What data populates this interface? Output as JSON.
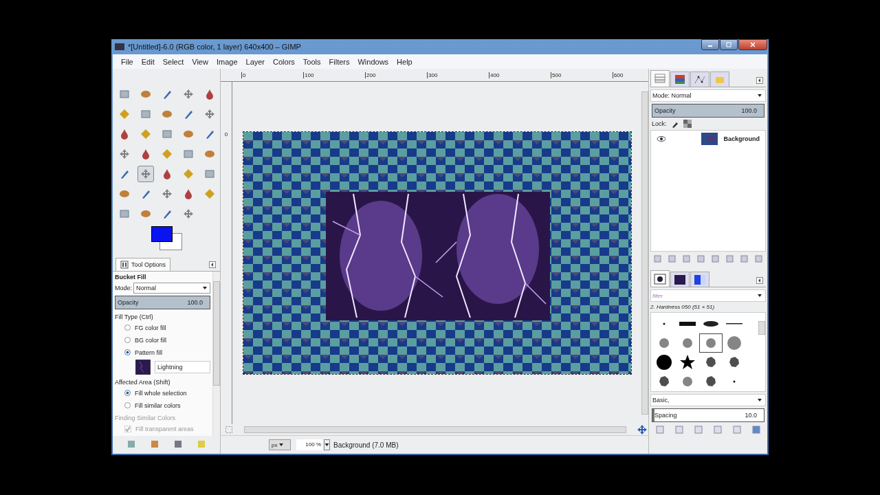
{
  "window": {
    "title": "*[Untitled]-6.0 (RGB color, 1 layer) 640x400 – GIMP"
  },
  "menu": [
    "File",
    "Edit",
    "Select",
    "View",
    "Image",
    "Layer",
    "Colors",
    "Tools",
    "Filters",
    "Windows",
    "Help"
  ],
  "toolbox": {
    "tools": [
      {
        "selected": false
      },
      {
        "selected": false
      },
      {
        "selected": false
      },
      {
        "selected": false
      },
      {
        "selected": false
      },
      {
        "selected": false
      },
      {
        "selected": false
      },
      {
        "selected": false
      },
      {
        "selected": false
      },
      {
        "selected": false
      },
      {
        "selected": false
      },
      {
        "selected": false
      },
      {
        "selected": false
      },
      {
        "selected": false
      },
      {
        "selected": false
      },
      {
        "selected": false
      },
      {
        "selected": false
      },
      {
        "selected": false
      },
      {
        "selected": false
      },
      {
        "selected": false
      },
      {
        "selected": false
      },
      {
        "selected": true
      },
      {
        "selected": false
      },
      {
        "selected": false
      },
      {
        "selected": false
      },
      {
        "selected": false
      },
      {
        "selected": false
      },
      {
        "selected": false
      },
      {
        "selected": false
      },
      {
        "selected": false
      },
      {
        "selected": false
      },
      {
        "selected": false
      },
      {
        "selected": false
      },
      {
        "selected": false
      }
    ]
  },
  "tool_options": {
    "tab": "Tool Options",
    "title": "Bucket Fill",
    "mode_label": "Mode:",
    "mode": "Normal",
    "opacity": {
      "label": "Opacity",
      "value": "100.0",
      "level": 1
    },
    "fill_type": {
      "heading": "Fill Type  (Ctrl)",
      "options": [
        {
          "label": "FG color fill",
          "selected": false
        },
        {
          "label": "BG color fill",
          "selected": false
        },
        {
          "label": "Pattern fill",
          "selected": true
        }
      ]
    },
    "pattern": "Lightning",
    "affected_area": {
      "heading": "Affected Area  (Shift)",
      "options": [
        {
          "label": "Fill whole selection",
          "selected": true
        },
        {
          "label": "Fill similar colors",
          "selected": false
        }
      ]
    },
    "similar_heading": "Finding Similar Colors",
    "fill_transparent": {
      "label": "Fill transparent areas",
      "checked": true,
      "disabled": true
    }
  },
  "canvas": {
    "ruler_labels": [
      "0",
      "100",
      "200",
      "300",
      "400",
      "500",
      "600"
    ],
    "vruler_label": "0",
    "unit": "px",
    "zoom": "100 %",
    "status": "Background (7.0 MB)"
  },
  "layers_dock": {
    "tabs": [
      {
        "selected": true
      },
      {
        "selected": false
      },
      {
        "selected": false
      },
      {
        "selected": false
      }
    ],
    "mode": "Mode: Normal",
    "opacity": {
      "label": "Opacity",
      "value": "100.0",
      "level": 1
    },
    "lock_label": "Lock:",
    "layers": [
      {
        "name": "Background",
        "visible": true
      }
    ]
  },
  "brushes_dock": {
    "tabs": [
      {
        "selected": true
      },
      {
        "selected": false
      },
      {
        "selected": false
      }
    ],
    "filter_placeholder": "filter",
    "brush_name": "2. Hardness 050 (51 × 51)",
    "brushes": [
      {
        "selected": false
      },
      {
        "selected": false
      },
      {
        "selected": false
      },
      {
        "selected": false
      },
      {
        "selected": false
      },
      {
        "selected": false
      },
      {
        "selected": true
      },
      {
        "selected": false
      },
      {
        "selected": false
      },
      {
        "selected": false
      },
      {
        "selected": false
      },
      {
        "selected": false
      },
      {
        "selected": false
      },
      {
        "selected": false
      },
      {
        "selected": false
      },
      {
        "selected": false
      }
    ],
    "tag": "Basic,",
    "spacing": {
      "label": "Spacing",
      "value": "10.0",
      "level": 0.02
    }
  }
}
